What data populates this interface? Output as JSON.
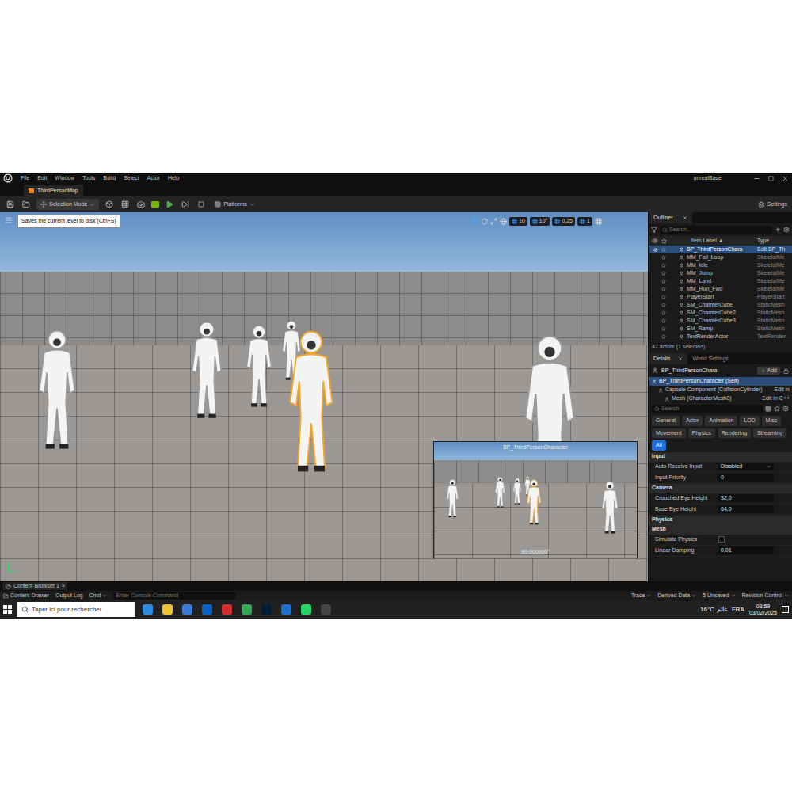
{
  "window": {
    "title": "ThirdPersonMap",
    "project": "unrealBase",
    "menus": [
      "File",
      "Edit",
      "Window",
      "Tools",
      "Build",
      "Select",
      "Actor",
      "Help"
    ]
  },
  "toolbar": {
    "selection_mode": "Selection Mode",
    "platforms": "Platforms",
    "settings": "Settings"
  },
  "tooltip": "Saves the current level to disk (Ctrl+S)",
  "viewport": {
    "toolbar_values": [
      "10",
      "10°",
      "0,25",
      "1"
    ],
    "preview": {
      "title": "BP_ThirdPersonCharacter",
      "angle": "90.000000°"
    }
  },
  "outliner": {
    "tab": "Outliner",
    "search_placeholder": "Search...",
    "columns": [
      "Item Label ▲",
      "Type"
    ],
    "rows": [
      {
        "label": "BP_ThirdPersonChara",
        "type": "Edit BP_Th",
        "selected": true
      },
      {
        "label": "MM_Fall_Loop",
        "type": "SkeletalMe",
        "selected": false
      },
      {
        "label": "MM_Idle",
        "type": "SkeletalMe",
        "selected": false
      },
      {
        "label": "MM_Jump",
        "type": "SkeletalMe",
        "selected": false
      },
      {
        "label": "MM_Land",
        "type": "SkeletalMe",
        "selected": false
      },
      {
        "label": "MM_Run_Fwd",
        "type": "SkeletalMe",
        "selected": false
      },
      {
        "label": "PlayerStart",
        "type": "PlayerStart",
        "selected": false
      },
      {
        "label": "SM_ChamferCube",
        "type": "StaticMesh",
        "selected": false
      },
      {
        "label": "SM_ChamferCube2",
        "type": "StaticMesh",
        "selected": false
      },
      {
        "label": "SM_ChamferCube3",
        "type": "StaticMesh",
        "selected": false
      },
      {
        "label": "SM_Ramp",
        "type": "StaticMesh",
        "selected": false
      },
      {
        "label": "TextRenderActor",
        "type": "TextRender",
        "selected": false
      }
    ],
    "count": "47 actors (1 selected)"
  },
  "details": {
    "tabs": [
      {
        "label": "Details",
        "selected": true
      },
      {
        "label": "World Settings",
        "selected": false
      }
    ],
    "actor": "BP_ThirdPersonChara",
    "add": "Add",
    "components": [
      {
        "label": "BP_ThirdPersonCharacter (Self)",
        "action": "",
        "selected": true
      },
      {
        "label": "Capsule Component (CollisionCylinder)",
        "action": "Edit in",
        "selected": false
      },
      {
        "label": "Mesh (CharacterMesh0)",
        "action": "Edit in C++",
        "selected": false
      }
    ],
    "search_placeholder": "Search",
    "filters": [
      {
        "label": "General",
        "selected": false
      },
      {
        "label": "Actor",
        "selected": false
      },
      {
        "label": "Animation",
        "selected": false
      },
      {
        "label": "LOD",
        "selected": false
      },
      {
        "label": "Misc",
        "selected": false
      },
      {
        "label": "Movement",
        "selected": false
      },
      {
        "label": "Physics",
        "selected": false
      },
      {
        "label": "Rendering",
        "selected": false
      },
      {
        "label": "Streaming",
        "selected": false
      },
      {
        "label": "All",
        "selected": true
      }
    ],
    "sections": [
      {
        "title": "Input",
        "rows": [
          {
            "label": "Auto Receive Input",
            "kind": "dropdown",
            "value": "Disabled"
          },
          {
            "label": "Input Priority",
            "kind": "number",
            "value": "0"
          }
        ]
      },
      {
        "title": "Camera",
        "rows": [
          {
            "label": "Crouched Eye Height",
            "kind": "number",
            "value": "32,0"
          },
          {
            "label": "Base Eye Height",
            "kind": "number",
            "value": "64,0"
          }
        ]
      },
      {
        "title": "Physics",
        "rows": []
      },
      {
        "title": "Mesh",
        "rows": [
          {
            "label": "Simulate Physics",
            "kind": "checkbox",
            "checked": false
          },
          {
            "label": "Linear Damping",
            "kind": "number",
            "value": "0,01"
          }
        ]
      }
    ]
  },
  "bottom": {
    "tab": "Content Browser 1",
    "tab_close": "×",
    "content_drawer": "Content Drawer",
    "output_log": "Output Log",
    "cmd": "Cmd",
    "console_placeholder": "Enter Console Command",
    "right": [
      "Trace",
      "Derived Data",
      "5 Unsaved",
      "Revision Control"
    ]
  },
  "taskbar": {
    "search_placeholder": "Taper ici pour rechercher",
    "temperature": "16°C",
    "weather": "غائم",
    "language": "FRA",
    "time": "03:59",
    "date": "03/02/2025"
  }
}
